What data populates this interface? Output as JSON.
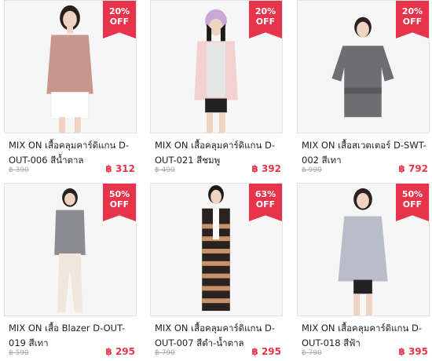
{
  "products": [
    {
      "title": "MIX ON เสื้อคลุมคาร์ดิแกน D-OUT-006 สีน้ำตาล",
      "old_price": "฿ 390",
      "price": "฿ 312",
      "discount": "20%",
      "off": "OFF",
      "colors": {
        "top": "#c9968e",
        "bottom": "#ffffff",
        "skin": "#efd3c3",
        "hair": "#2b1f1a"
      }
    },
    {
      "title": "MIX ON เสื้อคลุมคาร์ดิแกน D-OUT-021 สีชมพู",
      "old_price": "฿ 490",
      "price": "฿ 392",
      "discount": "20%",
      "off": "OFF",
      "colors": {
        "top": "#f2d1d0",
        "bottom": "#222222",
        "skin": "#efd3c3",
        "hair": "#1f1a1a"
      }
    },
    {
      "title": "MIX ON เสื้อสเวตเตอร์ D-SWT-002 สีเทา",
      "old_price": "฿ 990",
      "price": "฿ 792",
      "discount": "20%",
      "off": "OFF",
      "colors": {
        "top": "#6e6e72",
        "bottom": "#6e6e72",
        "skin": "#efd3c3",
        "hair": "#2a2220"
      }
    },
    {
      "title": "MIX ON เสื้อ Blazer D-OUT-019 สีเทา",
      "old_price": "฿ 590",
      "price": "฿ 295",
      "discount": "50%",
      "off": "OFF",
      "colors": {
        "top": "#8a8c92",
        "bottom": "#efe6dc",
        "skin": "#efd3c3",
        "hair": "#2a2220"
      }
    },
    {
      "title": "MIX ON เสื้อคลุมคาร์ดิแกน D-OUT-007 สีดำ-น้ำตาล",
      "old_price": "฿ 790",
      "price": "฿ 295",
      "discount": "63%",
      "off": "OFF",
      "colors": {
        "top": "#2a2220",
        "bottom": "#c8936a",
        "skin": "#efd3c3",
        "hair": "#1f1a1a"
      }
    },
    {
      "title": "MIX ON เสื้อคลุมคาร์ดิแกน D-OUT-018 สีฟ้า",
      "old_price": "฿ 790",
      "price": "฿ 395",
      "discount": "50%",
      "off": "OFF",
      "colors": {
        "top": "#b9bcc9",
        "bottom": "#222222",
        "skin": "#efd3c3",
        "hair": "#2a2220"
      }
    }
  ]
}
